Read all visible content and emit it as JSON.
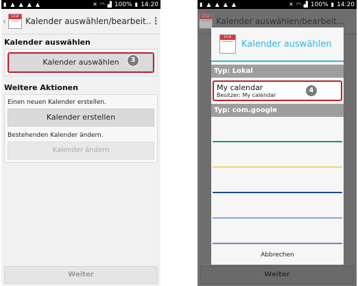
{
  "status": {
    "battery": "100%",
    "time": "14:20"
  },
  "left": {
    "title": "Kalender auswählen/bearbeit…",
    "section1": "Kalender auswählen",
    "select_btn": "Kalender auswählen",
    "step_badge": "3",
    "section2": "Weitere Aktionen",
    "create_text": "Einen neuen Kalender erstellen.",
    "create_btn": "Kalender erstellen",
    "edit_text": "Bestehenden Kalender ändern.",
    "edit_btn": "Kalender ändern",
    "next_btn": "Weiter"
  },
  "right": {
    "bg_title": "Kalender auswählen/bearbeit…",
    "dialog_title": "Kalender auswählen",
    "type_local": "Typ: Lokal",
    "cal_name": "My calendar",
    "cal_owner": "Besitzer: My calendar",
    "step_badge": "4",
    "type_google": "Typ: com.google",
    "google_colors": [
      "#0f9d58",
      "#f4d56b",
      "#1a4c8a",
      "#7da7e0",
      "#8b7dd8"
    ],
    "cancel": "Abbrechen",
    "next_btn": "Weiter"
  },
  "icons": [
    "sim-icon",
    "upload-icon",
    "mute-icon",
    "wifi-icon",
    "signal-icon",
    "battery-icon",
    "overflow-menu-icon",
    "lcal-app-icon"
  ]
}
